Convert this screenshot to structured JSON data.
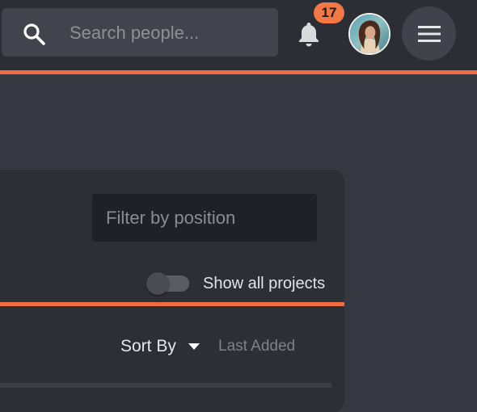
{
  "header": {
    "search": {
      "placeholder": "Search people...",
      "icon": "search-icon"
    },
    "notifications": {
      "icon": "bell-icon",
      "count": "17",
      "badge_color": "#f37845"
    },
    "avatar": {
      "icon": "user-avatar"
    },
    "menu": {
      "icon": "hamburger-menu-icon"
    },
    "accent_color": "#ef6c43"
  },
  "filters": {
    "position_placeholder": "Filter by position",
    "show_all_projects_label": "Show all projects",
    "show_all_projects_on": false
  },
  "sort": {
    "label": "Sort By",
    "value": "Last Added"
  }
}
